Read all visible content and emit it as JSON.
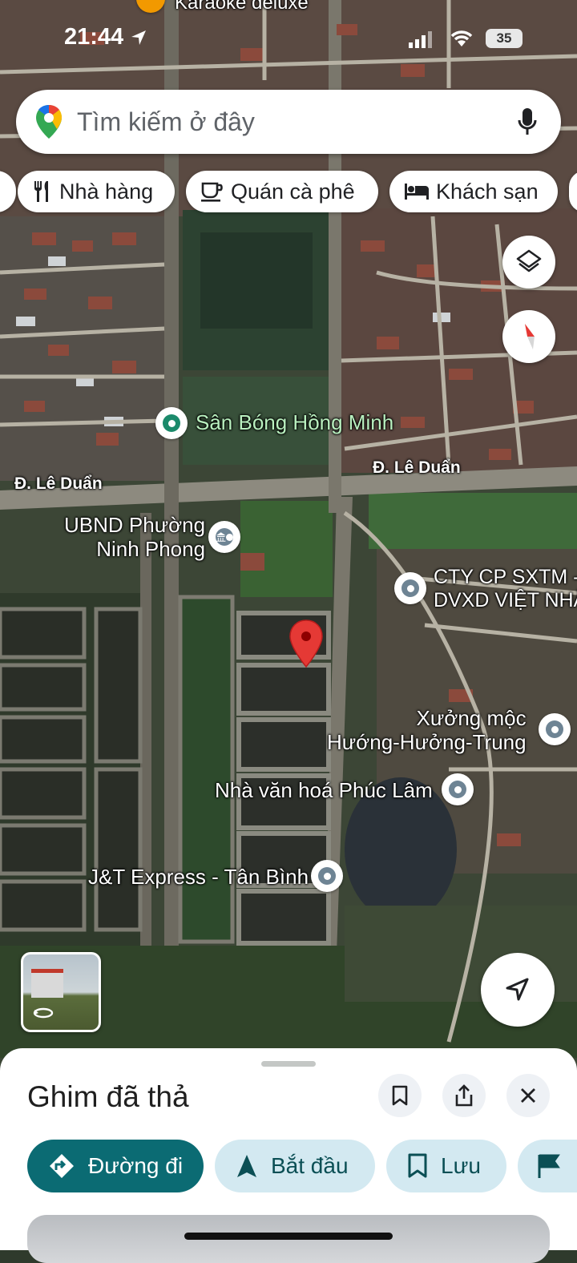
{
  "status_bar": {
    "time": "21:44",
    "battery": "35"
  },
  "search": {
    "placeholder": "Tìm kiếm ở đây"
  },
  "categories": [
    {
      "label": "Nhà hàng",
      "icon": "restaurant-icon"
    },
    {
      "label": "Quán cà phê",
      "icon": "coffee-icon"
    },
    {
      "label": "Khách sạn",
      "icon": "hotel-icon"
    }
  ],
  "map": {
    "top_partial_label": "Karaoke deluxe",
    "labels": {
      "san_bong": "Sân Bóng Hồng Minh",
      "road_left": "Đ. Lê Duẩn",
      "road_right": "Đ. Lê Duẩn",
      "ubnd_line1": "UBND Phường",
      "ubnd_line2": "Ninh Phong",
      "cty_line1": "CTY CP SXTM -",
      "cty_line2": "DVXD VIỆT NHẬ",
      "xuong_line1": "Xưởng mộc",
      "xuong_line2": "Hướng-Hưởng-Trung",
      "nha_van_hoa": "Nhà văn hoá Phúc Lâm",
      "jt_express": "J&T Express - Tân Bình"
    }
  },
  "sheet": {
    "title": "Ghim đã thả",
    "actions": [
      {
        "label": "Đường đi",
        "icon": "directions-icon"
      },
      {
        "label": "Bắt đầu",
        "icon": "navigation-arrow-icon"
      },
      {
        "label": "Lưu",
        "icon": "bookmark-icon"
      }
    ]
  },
  "colors": {
    "accent_teal": "#0b6b73",
    "pill_light": "#d3e9f1",
    "pin_red": "#e53935",
    "poi_green": "#1b8a6b"
  }
}
